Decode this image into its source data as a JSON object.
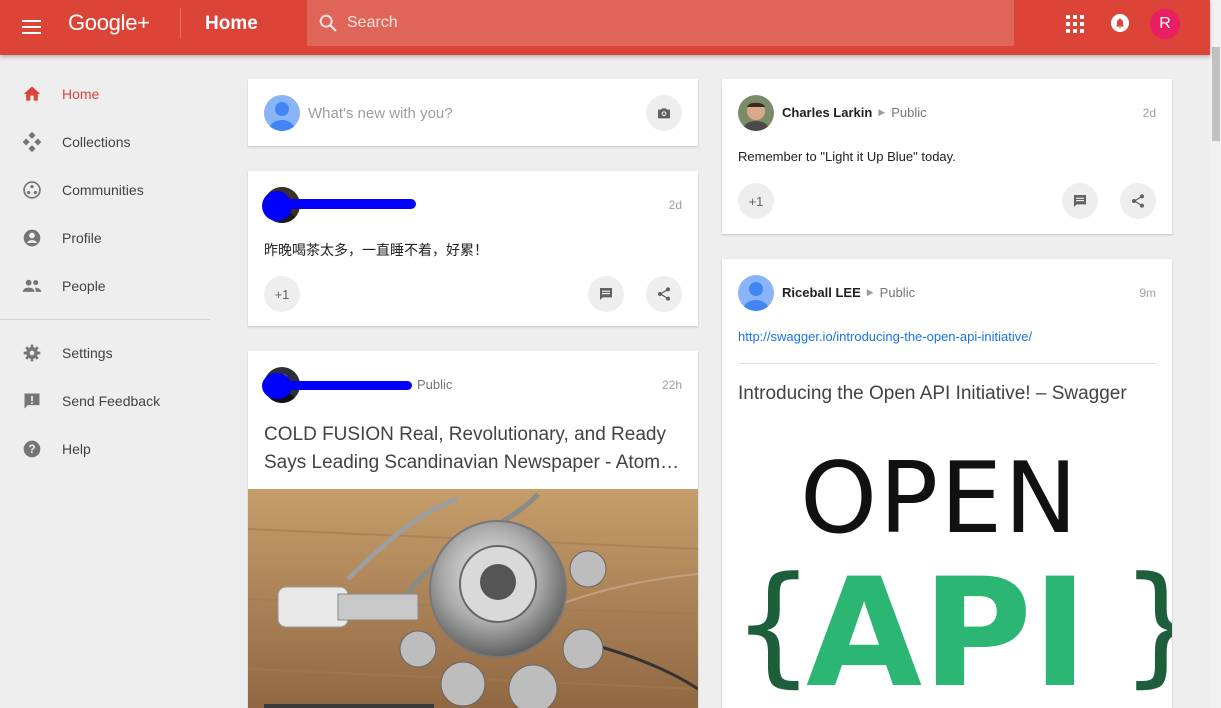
{
  "header": {
    "logo": "Google+",
    "title": "Home",
    "search_placeholder": "Search",
    "avatar_initial": "R"
  },
  "sidebar": {
    "items": [
      {
        "label": "Home",
        "icon": "home-icon",
        "active": true
      },
      {
        "label": "Collections",
        "icon": "collections-icon"
      },
      {
        "label": "Communities",
        "icon": "communities-icon"
      },
      {
        "label": "Profile",
        "icon": "profile-icon"
      },
      {
        "label": "People",
        "icon": "people-icon"
      }
    ],
    "secondary": [
      {
        "label": "Settings",
        "icon": "settings-icon"
      },
      {
        "label": "Send Feedback",
        "icon": "feedback-icon"
      },
      {
        "label": "Help",
        "icon": "help-icon"
      }
    ]
  },
  "composer": {
    "placeholder": "What's new with you?"
  },
  "posts": [
    {
      "timestamp": "2d",
      "text": "昨晚喝茶太多，一直睡不着，好累！",
      "plus_one": "+1"
    },
    {
      "visibility": "Public",
      "timestamp": "22h",
      "title": "COLD FUSION Real, Revolutionary, and Ready Says Leading Scandinavian Newspaper - Atom…"
    },
    {
      "author": "Charles Larkin",
      "visibility": "Public",
      "timestamp": "2d",
      "text": "Remember to \"Light it Up Blue\" today.",
      "plus_one": "+1"
    },
    {
      "author": "Riceball LEE",
      "visibility": "Public",
      "timestamp": "9m",
      "link": "http://swagger.io/introducing-the-open-api-initiative/",
      "link_title": "Introducing the Open API Initiative! – Swagger",
      "image_text_top": "OPEN",
      "image_text_left_brace": "{",
      "image_text_api": "API",
      "image_text_right_brace": "}"
    }
  ],
  "colors": {
    "brand": "#db4437",
    "link": "#1a73e8",
    "openapi_green": "#2bb673",
    "openapi_lime": "#c4e35a"
  }
}
